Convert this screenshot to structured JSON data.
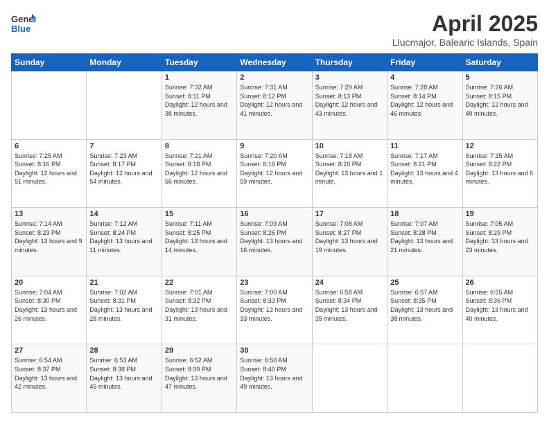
{
  "logo": {
    "line1": "General",
    "line2": "Blue"
  },
  "title": "April 2025",
  "subtitle": "Llucmajor, Balearic Islands, Spain",
  "weekdays": [
    "Sunday",
    "Monday",
    "Tuesday",
    "Wednesday",
    "Thursday",
    "Friday",
    "Saturday"
  ],
  "weeks": [
    [
      null,
      null,
      {
        "day": "1",
        "sunrise": "7:32 AM",
        "sunset": "8:11 PM",
        "daylight": "12 hours and 38 minutes."
      },
      {
        "day": "2",
        "sunrise": "7:31 AM",
        "sunset": "8:12 PM",
        "daylight": "12 hours and 41 minutes."
      },
      {
        "day": "3",
        "sunrise": "7:29 AM",
        "sunset": "8:13 PM",
        "daylight": "12 hours and 43 minutes."
      },
      {
        "day": "4",
        "sunrise": "7:28 AM",
        "sunset": "8:14 PM",
        "daylight": "12 hours and 46 minutes."
      },
      {
        "day": "5",
        "sunrise": "7:26 AM",
        "sunset": "8:15 PM",
        "daylight": "12 hours and 49 minutes."
      }
    ],
    [
      {
        "day": "6",
        "sunrise": "7:25 AM",
        "sunset": "8:16 PM",
        "daylight": "12 hours and 51 minutes."
      },
      {
        "day": "7",
        "sunrise": "7:23 AM",
        "sunset": "8:17 PM",
        "daylight": "12 hours and 54 minutes."
      },
      {
        "day": "8",
        "sunrise": "7:21 AM",
        "sunset": "8:18 PM",
        "daylight": "12 hours and 56 minutes."
      },
      {
        "day": "9",
        "sunrise": "7:20 AM",
        "sunset": "8:19 PM",
        "daylight": "12 hours and 59 minutes."
      },
      {
        "day": "10",
        "sunrise": "7:18 AM",
        "sunset": "8:20 PM",
        "daylight": "13 hours and 1 minute."
      },
      {
        "day": "11",
        "sunrise": "7:17 AM",
        "sunset": "8:21 PM",
        "daylight": "13 hours and 4 minutes."
      },
      {
        "day": "12",
        "sunrise": "7:15 AM",
        "sunset": "8:22 PM",
        "daylight": "13 hours and 6 minutes."
      }
    ],
    [
      {
        "day": "13",
        "sunrise": "7:14 AM",
        "sunset": "8:23 PM",
        "daylight": "13 hours and 9 minutes."
      },
      {
        "day": "14",
        "sunrise": "7:12 AM",
        "sunset": "8:24 PM",
        "daylight": "13 hours and 11 minutes."
      },
      {
        "day": "15",
        "sunrise": "7:11 AM",
        "sunset": "8:25 PM",
        "daylight": "13 hours and 14 minutes."
      },
      {
        "day": "16",
        "sunrise": "7:09 AM",
        "sunset": "8:26 PM",
        "daylight": "13 hours and 16 minutes."
      },
      {
        "day": "17",
        "sunrise": "7:08 AM",
        "sunset": "8:27 PM",
        "daylight": "13 hours and 19 minutes."
      },
      {
        "day": "18",
        "sunrise": "7:07 AM",
        "sunset": "8:28 PM",
        "daylight": "13 hours and 21 minutes."
      },
      {
        "day": "19",
        "sunrise": "7:05 AM",
        "sunset": "8:29 PM",
        "daylight": "13 hours and 23 minutes."
      }
    ],
    [
      {
        "day": "20",
        "sunrise": "7:04 AM",
        "sunset": "8:30 PM",
        "daylight": "13 hours and 26 minutes."
      },
      {
        "day": "21",
        "sunrise": "7:02 AM",
        "sunset": "8:31 PM",
        "daylight": "13 hours and 28 minutes."
      },
      {
        "day": "22",
        "sunrise": "7:01 AM",
        "sunset": "8:32 PM",
        "daylight": "13 hours and 31 minutes."
      },
      {
        "day": "23",
        "sunrise": "7:00 AM",
        "sunset": "8:33 PM",
        "daylight": "13 hours and 33 minutes."
      },
      {
        "day": "24",
        "sunrise": "6:58 AM",
        "sunset": "8:34 PM",
        "daylight": "13 hours and 35 minutes."
      },
      {
        "day": "25",
        "sunrise": "6:57 AM",
        "sunset": "8:35 PM",
        "daylight": "13 hours and 38 minutes."
      },
      {
        "day": "26",
        "sunrise": "6:55 AM",
        "sunset": "8:36 PM",
        "daylight": "13 hours and 40 minutes."
      }
    ],
    [
      {
        "day": "27",
        "sunrise": "6:54 AM",
        "sunset": "8:37 PM",
        "daylight": "13 hours and 42 minutes."
      },
      {
        "day": "28",
        "sunrise": "6:53 AM",
        "sunset": "8:38 PM",
        "daylight": "13 hours and 45 minutes."
      },
      {
        "day": "29",
        "sunrise": "6:52 AM",
        "sunset": "8:39 PM",
        "daylight": "13 hours and 47 minutes."
      },
      {
        "day": "30",
        "sunrise": "6:50 AM",
        "sunset": "8:40 PM",
        "daylight": "13 hours and 49 minutes."
      },
      null,
      null,
      null
    ]
  ],
  "labels": {
    "sunrise": "Sunrise:",
    "sunset": "Sunset:",
    "daylight": "Daylight:"
  }
}
